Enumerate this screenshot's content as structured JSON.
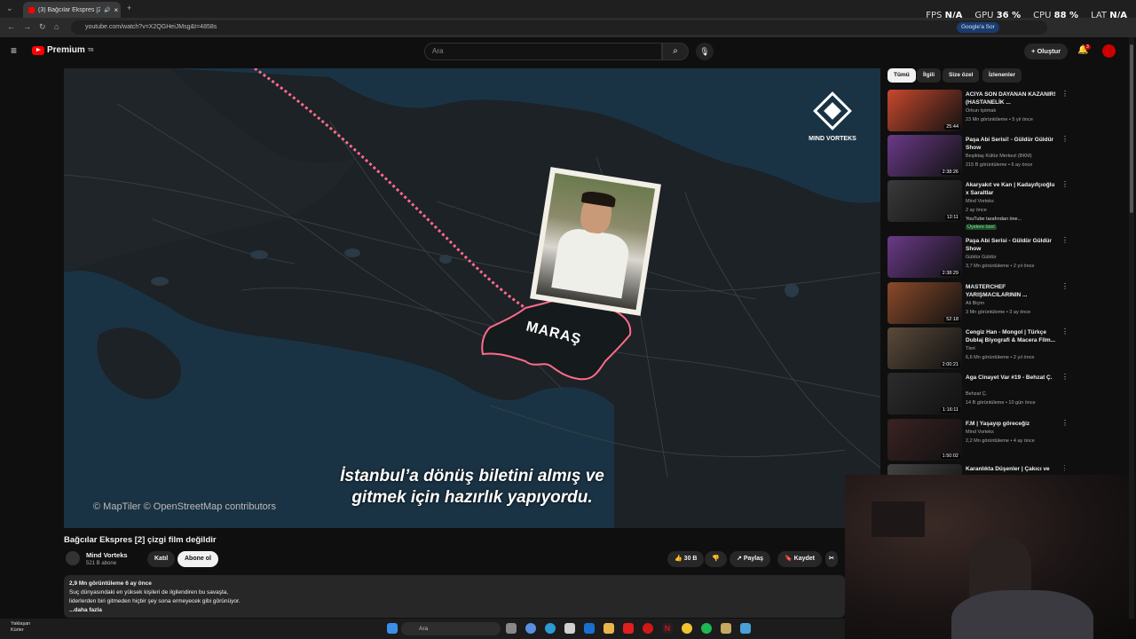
{
  "browser": {
    "tab_title": "(3) Bağcılar Ekspres [2] çizgi",
    "url": "youtube.com/watch?v=X2QGHeiJMsg&t=4858s",
    "google_sor": "Google'a Sor"
  },
  "overlay": {
    "fps_label": "FPS",
    "fps": "N/A",
    "gpu_label": "GPU",
    "gpu": "36 %",
    "cpu_label": "CPU",
    "cpu": "88 %",
    "lat_label": "LAT",
    "lat": "N/A"
  },
  "header": {
    "brand": "Premium",
    "brand_region": "TR",
    "search_placeholder": "Ara",
    "create_label": "Oluştur",
    "notif_count": "3"
  },
  "video": {
    "watermark": "MIND VORTEKS",
    "map_label": "MARAŞ",
    "subtitle_line1": "İstanbul’a dönüş biletini almış ve",
    "subtitle_line2": "gitmek için hazırlık yapıyordu.",
    "credit": "© MapTiler © OpenStreetMap contributors"
  },
  "meta": {
    "title": "Bağcılar Ekspres [2] çizgi film değildir",
    "channel": "Mind Vorteks",
    "subscribers": "521 B abone",
    "join_label": "Katıl",
    "subscribe_label": "Abone ol",
    "likes": "30 B",
    "share_label": "Paylaş",
    "save_label": "Kaydet",
    "views_line": "2,9 Mn görüntüleme  6 ay önce",
    "desc_line1": "Suç dünyasındaki en yüksek kişileri de ilgilendiren bu savaşta,",
    "desc_line2": "liderlerden biri gitmeden hiçbir şey sona ermeyecek gibi görünüyor.",
    "more_label": "...daha fazla"
  },
  "chips": [
    "Tümü",
    "İlgili",
    "Size özel",
    "İzlenenler"
  ],
  "recs": [
    {
      "title": "ACIYA SON DAYANAN KAZANIR! (HASTANELİK ...",
      "channel": "Orkun Işıtmak",
      "meta": "23 Mn görüntüleme • 5 yıl önce",
      "duration": "25:44",
      "color": "#c8482e",
      "badge": ""
    },
    {
      "title": "Paşa Abi Serisi! - Güldür Güldür Show",
      "channel": "Beşiktaş Kültür Merkezi (BKM)",
      "meta": "215 B görüntüleme • 6 ay önce",
      "duration": "2:38:26",
      "color": "#6a3a88",
      "badge": ""
    },
    {
      "title": "Akaryakıt ve Kan | Kadayıfçıoğlu x Saraltlar",
      "channel": "Mind Vorteks",
      "meta": "2 ay önce",
      "duration": "12:11",
      "color": "#3a3a3a",
      "badge": "YouTube tarafından öne...",
      "badge2": "Üyelere özel"
    },
    {
      "title": "Paşa Abi Serisi - Güldür Güldür Show",
      "channel": "Güldür Güldür",
      "meta": "3,7 Mn görüntüleme • 2 yıl önce",
      "duration": "2:38:29",
      "color": "#6a3a88",
      "badge": ""
    },
    {
      "title": "MASTERCHEF YARIŞMACILARININ ...",
      "channel": "Ali Biçim",
      "meta": "3 Mn görüntüleme • 3 ay önce",
      "duration": "52:18",
      "color": "#8a4a2a",
      "badge": ""
    },
    {
      "title": "Cengiz Han - Mongol | Türkçe Dublaj Biyografi & Macera Film...",
      "channel": "Tleri",
      "meta": "6,6 Mn görüntüleme • 2 yıl önce",
      "duration": "2:00:21",
      "color": "#5a4a3a",
      "badge": ""
    },
    {
      "title": "Aga Cinayet Var #19 - Behzat Ç.",
      "channel": "Behzat Ç.",
      "meta": "14 B görüntüleme • 10 gün önce",
      "duration": "1:16:11",
      "color": "#2c2c2c",
      "badge": ""
    },
    {
      "title": "F.M | Yaşayıp göreceğiz",
      "channel": "Mind Vorteks",
      "meta": "2,2 Mn görüntüleme • 4 ay önce",
      "duration": "1:50:02",
      "color": "#3a2222",
      "badge": ""
    },
    {
      "title": "Karanlıkta Düşenler | Çakıcı ve",
      "channel": "",
      "meta": "",
      "duration": "",
      "color": "#444",
      "badge": ""
    }
  ],
  "taskbar": {
    "weather_line1": "Yaklaşan",
    "weather_line2": "Kürler",
    "search": "Ara"
  }
}
